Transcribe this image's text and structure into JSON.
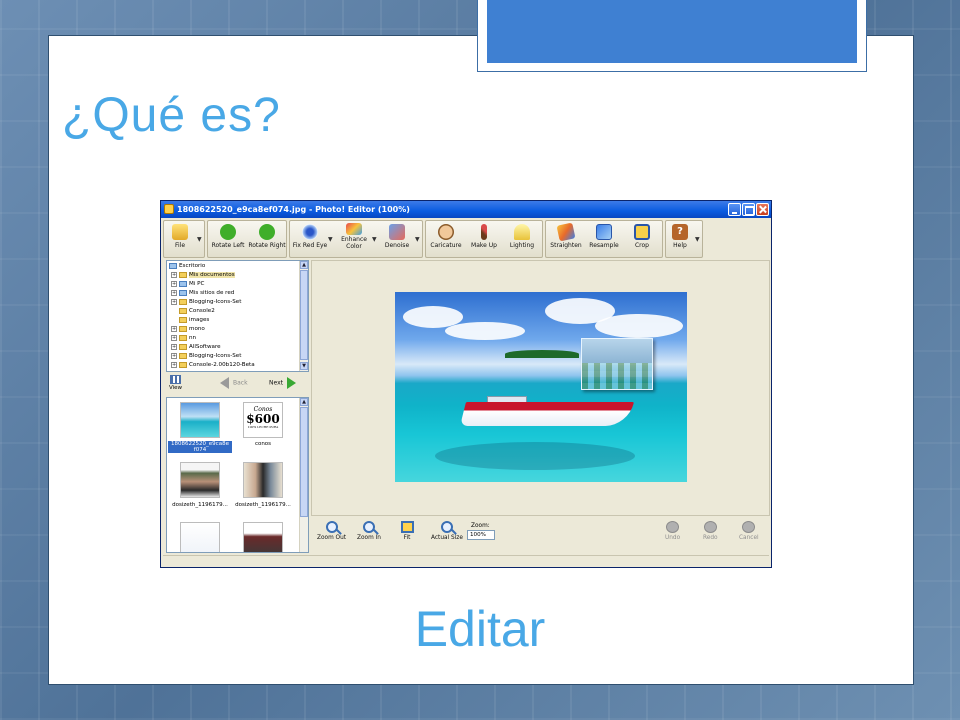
{
  "slide": {
    "title": "¿Qué es?",
    "subtitle": "Editar",
    "colors": {
      "title": "#49a8e6",
      "accent": "#3f80d2"
    }
  },
  "window": {
    "title": "1808622520_e9ca8ef074.jpg - Photo! Editor (100%)"
  },
  "toolbar": {
    "file": "File",
    "rotate_left": "Rotate Left",
    "rotate_right": "Rotate Right",
    "fix_red_eye": "Fix Red Eye",
    "enhance_color_1": "Enhance",
    "enhance_color_2": "Color",
    "denoise": "Denoise",
    "caricature": "Caricature",
    "make_up": "Make Up",
    "lighting": "Lighting",
    "straighten": "Straighten",
    "resample": "Resample",
    "crop": "Crop",
    "help": "Help"
  },
  "tree": {
    "root": "Escritorio",
    "items": [
      "Mis documentos",
      "Mi PC",
      "Mis sitios de red",
      "Blogging-Icons-Set",
      "Console2",
      "images",
      "mono",
      "nn",
      "AllSoftware",
      "Blogging-Icons-Set",
      "Console-2.00b120-Beta"
    ]
  },
  "nav": {
    "view": "View",
    "back": "Back",
    "next": "Next"
  },
  "thumbnails": [
    {
      "caption_1": "1808622520_e9ca8e",
      "caption_2": "f074"
    },
    {
      "caption_1": "conos"
    },
    {
      "caption_1": "dosizeth_1196179..."
    },
    {
      "caption_1": "dosizeth_1196179..."
    }
  ],
  "thumbnail_texts": {
    "conos_line1": "Conos",
    "conos_line2": "$600",
    "conos_line3": "100% LECHE PURA"
  },
  "bottom": {
    "zoom_out": "Zoom Out",
    "zoom_in": "Zoom In",
    "fit": "Fit",
    "actual_size": "Actual Size",
    "zoom_label": "Zoom:",
    "zoom_value": "100%",
    "undo": "Undo",
    "redo": "Redo",
    "cancel": "Cancel"
  }
}
